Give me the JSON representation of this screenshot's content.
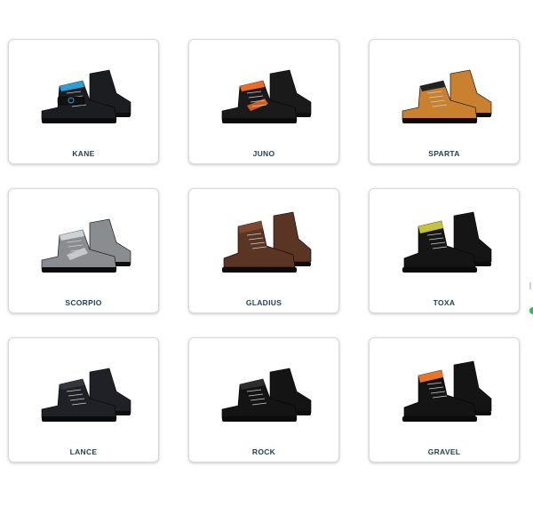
{
  "products": [
    {
      "name": "KANE",
      "image": "black-leather-low-shoe-with-velcro-strap",
      "upper": "#1b1d20",
      "accent": "#2b9fd6",
      "style": "strap"
    },
    {
      "name": "JUNO",
      "image": "black-suede-shoe-with-orange-collar",
      "upper": "#1a1a1a",
      "accent": "#f06a25",
      "style": "sport"
    },
    {
      "name": "SPARTA",
      "image": "tan-nubuck-shoe-with-black-collar",
      "upper": "#c9812f",
      "accent": "#222222",
      "style": "low"
    },
    {
      "name": "SCORPIO",
      "image": "grey-mesh-sport-shoe",
      "upper": "#8a8d90",
      "accent": "#cfd2d4",
      "style": "sport"
    },
    {
      "name": "GLADIUS",
      "image": "brown-leather-ankle-boot",
      "upper": "#5a3524",
      "accent": "#7a4a33",
      "style": "boot"
    },
    {
      "name": "TOXA",
      "image": "black-ankle-boot-with-yellow-accents",
      "upper": "#151515",
      "accent": "#c8c23a",
      "style": "boot"
    },
    {
      "name": "LANCE",
      "image": "black-leather-lace-up-shoe",
      "upper": "#1f2126",
      "accent": "#33363c",
      "style": "low"
    },
    {
      "name": "ROCK",
      "image": "black-leather-lace-up-shoe",
      "upper": "#141414",
      "accent": "#2e2e2e",
      "style": "low"
    },
    {
      "name": "GRAVEL",
      "image": "black-shoe-with-orange-padded-collar",
      "upper": "#141414",
      "accent": "#e8732c",
      "style": "boot"
    }
  ]
}
